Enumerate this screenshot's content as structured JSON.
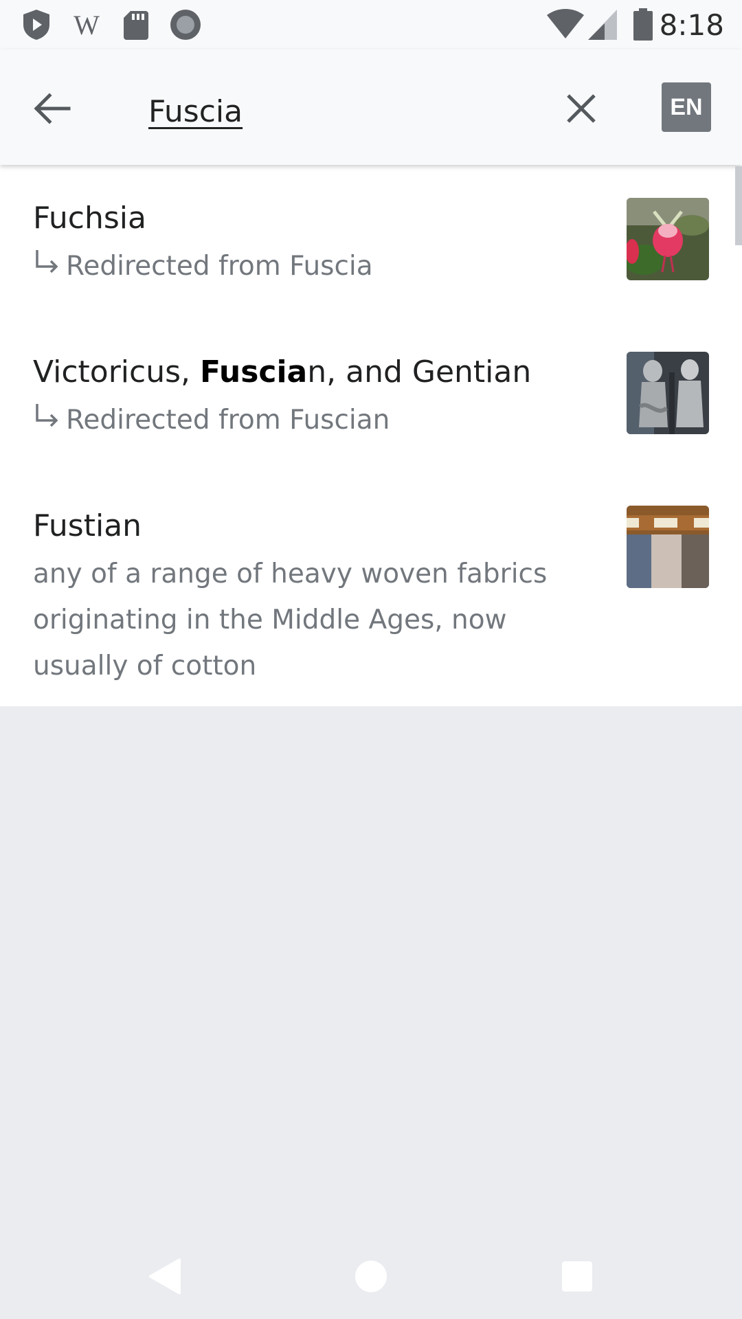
{
  "status_bar": {
    "time": "8:18",
    "left_icons": [
      "shield-play-icon",
      "wikipedia-w-icon",
      "sd-card-icon",
      "record-circle-icon"
    ],
    "right_icons": [
      "wifi-icon",
      "cellular-signal-icon",
      "battery-icon"
    ]
  },
  "search": {
    "query": "Fuscia",
    "language_label": "EN"
  },
  "results": [
    {
      "title": "Fuchsia",
      "subtitle": "Redirected from Fuscia",
      "thumbnail": "fuchsia-flower-photo"
    },
    {
      "title_before": "Victoricus, ",
      "title_bold": "Fuscia",
      "title_after": "n, and Gentian",
      "subtitle": "Redirected from Fuscian",
      "thumbnail": "statues-photo"
    },
    {
      "title": "Fustian",
      "description": "any of a range of heavy woven fabrics originating in the Middle Ages, now usually of cotton",
      "thumbnail": "fabric-swatches-photo"
    }
  ],
  "nav_bar": {
    "buttons": [
      "back-triangle-icon",
      "home-circle-icon",
      "recents-square-icon"
    ]
  },
  "colors": {
    "app_bar_bg": "#f8f9fa",
    "empty_area_bg": "#eaecf0",
    "title_text": "#202122",
    "secondary_text": "#72777d",
    "lang_badge_bg": "#72777d"
  }
}
